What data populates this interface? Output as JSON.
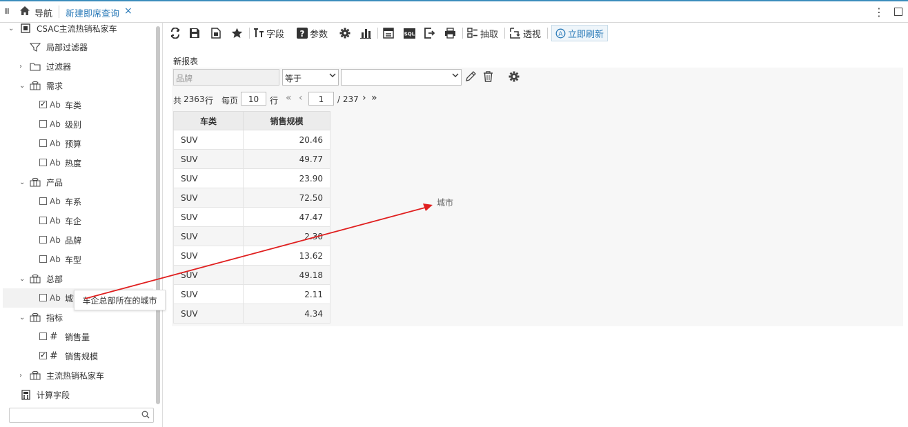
{
  "topbar": {
    "menu_glyph": "III",
    "nav_label": "导航",
    "tab_label": "新建即席查询",
    "tab_close": "×",
    "more_glyph": "⋮"
  },
  "tree": {
    "root": "CSAC主流热销私家车",
    "local_filter": "局部过滤器",
    "filters": "过滤器",
    "groups": [
      {
        "label": "需求",
        "fields": [
          {
            "label": "车类",
            "checked": true,
            "type": "Ab"
          },
          {
            "label": "级别",
            "checked": false,
            "type": "Ab"
          },
          {
            "label": "预算",
            "checked": false,
            "type": "Ab"
          },
          {
            "label": "热度",
            "checked": false,
            "type": "Ab"
          }
        ]
      },
      {
        "label": "产品",
        "fields": [
          {
            "label": "车系",
            "checked": false,
            "type": "Ab"
          },
          {
            "label": "车企",
            "checked": false,
            "type": "Ab"
          },
          {
            "label": "品牌",
            "checked": false,
            "type": "Ab"
          },
          {
            "label": "车型",
            "checked": false,
            "type": "Ab"
          }
        ]
      },
      {
        "label": "总部",
        "fields": [
          {
            "label": "城市",
            "checked": false,
            "type": "Ab"
          }
        ]
      },
      {
        "label": "指标",
        "fields": [
          {
            "label": "销售量",
            "checked": false,
            "type": "#"
          },
          {
            "label": "销售规模",
            "checked": true,
            "type": "#"
          }
        ]
      }
    ],
    "sub_table": "主流热销私家车",
    "calc_field": "计算字段",
    "tooltip": "车企总部所在的城市"
  },
  "toolbar": {
    "fields_label": "字段",
    "params_label": "参数",
    "extract_label": "抽取",
    "pivot_label": "透视",
    "refresh_label": "立即刷新"
  },
  "report": {
    "title": "新报表",
    "filter_field_placeholder": "品牌",
    "filter_operator": "等于",
    "pager": {
      "total_prefix": "共",
      "total": "2363",
      "total_unit": "行",
      "per_page_label": "每页",
      "per_page": "10",
      "per_page_unit": "行",
      "current_page": "1",
      "total_pages": "/ 237"
    },
    "columns": [
      "车类",
      "销售规模"
    ],
    "rows": [
      [
        "SUV",
        "20.46"
      ],
      [
        "SUV",
        "49.77"
      ],
      [
        "SUV",
        "23.90"
      ],
      [
        "SUV",
        "72.50"
      ],
      [
        "SUV",
        "47.47"
      ],
      [
        "SUV",
        "2.30"
      ],
      [
        "SUV",
        "13.62"
      ],
      [
        "SUV",
        "49.18"
      ],
      [
        "SUV",
        "2.11"
      ],
      [
        "SUV",
        "4.34"
      ]
    ],
    "drop_label": "城市"
  },
  "colors": {
    "accent": "#2a7ab8",
    "arrow": "#e02020"
  }
}
